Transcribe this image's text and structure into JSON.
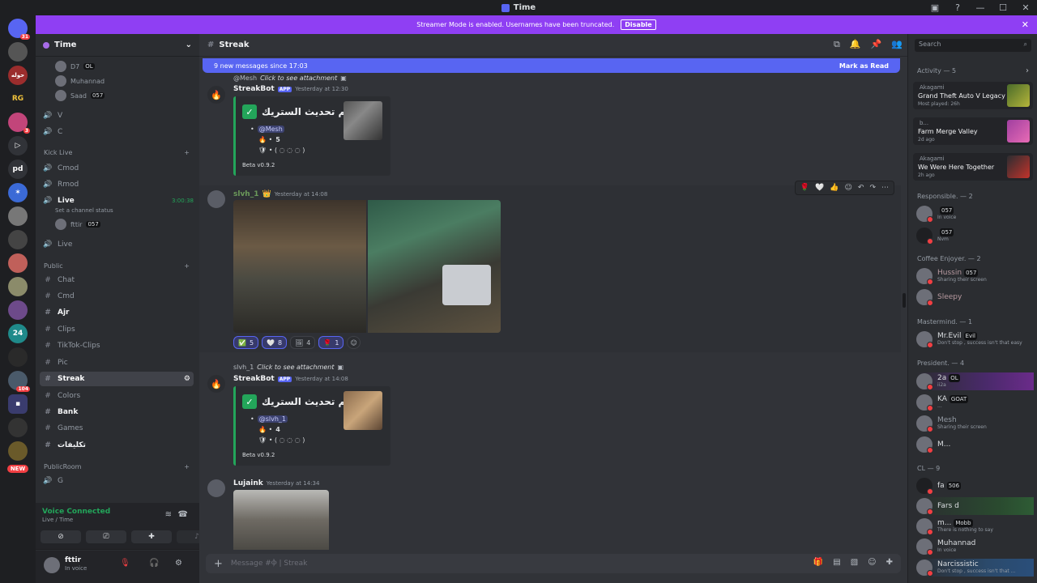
{
  "window": {
    "title": "Time"
  },
  "banner": {
    "text": "Streamer Mode is enabled. Usernames have been truncated.",
    "button": "Disable"
  },
  "servers": {
    "items": [
      {
        "label": "",
        "badge": "31"
      },
      {
        "label": "",
        "badge": ""
      },
      {
        "label": "حوله",
        "badge": ""
      },
      {
        "label": "RG",
        "badge": ""
      },
      {
        "label": "",
        "badge": "3"
      },
      {
        "label": "",
        "badge": ""
      },
      {
        "label": "pd",
        "badge": ""
      },
      {
        "label": "",
        "badge": ""
      },
      {
        "label": "",
        "badge": ""
      },
      {
        "label": "",
        "badge": ""
      },
      {
        "label": "",
        "badge": ""
      },
      {
        "label": "",
        "badge": ""
      },
      {
        "label": "",
        "badge": ""
      },
      {
        "label": "24",
        "badge": ""
      },
      {
        "label": "",
        "badge": ""
      },
      {
        "label": "",
        "badge": "104"
      },
      {
        "label": "",
        "badge": ""
      },
      {
        "label": "",
        "badge": ""
      },
      {
        "label": "",
        "badge": ""
      }
    ],
    "new_badge": "NEW"
  },
  "sidebar": {
    "guild_name": "Time",
    "voice_users_top": [
      {
        "name": "D7",
        "tag": "OL"
      },
      {
        "name": "Muhannad",
        "tag": ""
      },
      {
        "name": "Saad",
        "tag": "057"
      }
    ],
    "channels_top": [
      {
        "name": "V"
      },
      {
        "name": "C"
      }
    ],
    "category_kick": "Kick Live",
    "kick_channels": [
      {
        "name": "Cmod"
      },
      {
        "name": "Rmod"
      },
      {
        "name": "Live",
        "timer": "3:00:38",
        "status": "Set a channel status"
      },
      {
        "name": "Live"
      }
    ],
    "kick_live_user": {
      "name": "fttir",
      "tag": "057"
    },
    "category_public": "Public",
    "public_channels": [
      {
        "name": "Chat"
      },
      {
        "name": "Cmd"
      },
      {
        "name": "Ajr"
      },
      {
        "name": "Clips"
      },
      {
        "name": "TikTok-Clips"
      },
      {
        "name": "Pic"
      },
      {
        "name": "Streak"
      },
      {
        "name": "Colors"
      },
      {
        "name": "Bank"
      },
      {
        "name": "Games"
      },
      {
        "name": "تكليفات"
      }
    ],
    "category_publicroom": "PublicRoom",
    "publicroom_channels": [
      {
        "name": "G"
      }
    ]
  },
  "voice_panel": {
    "status": "Voice Connected",
    "location": "Live / Time"
  },
  "user_panel": {
    "name": "fttir",
    "status": "In voice"
  },
  "chat": {
    "channel_name": "Streak",
    "new_messages": "9 new messages since 17:03",
    "mark_read": "Mark as Read",
    "msg1": {
      "reply_user": "@Mesh",
      "reply_text": "Click to see attachment",
      "author": "StreakBot",
      "app_tag": "APP",
      "time": "Yesterday at 12:30",
      "embed_title": "تم تحديث الستريك •",
      "mention": "@Mesh",
      "count": "5",
      "footer": "Beta v0.9.2"
    },
    "msg2": {
      "author": "slvh_1",
      "time": "Yesterday at 14:08",
      "reactions": [
        {
          "emoji": "✅",
          "count": "5"
        },
        {
          "emoji": "🤍",
          "count": "8"
        },
        {
          "emoji": "🖼",
          "count": "4"
        },
        {
          "emoji": "🌹",
          "count": "1"
        }
      ]
    },
    "msg3": {
      "reply_user": "slvh_1",
      "reply_text": "Click to see attachment",
      "author": "StreakBot",
      "app_tag": "APP",
      "time": "Yesterday at 14:08",
      "embed_title": "تم تحديث الستريك •",
      "mention": "@slvh_1",
      "count": "4",
      "footer": "Beta v0.9.2"
    },
    "msg4": {
      "author": "Lujaink",
      "time": "Yesterday at 14:34"
    },
    "input_placeholder": "Message #Ⲫ | Streak"
  },
  "members": {
    "search_placeholder": "Search",
    "activity_header": "Activity — 5",
    "activities": [
      {
        "user": "Akagami",
        "game": "Grand Theft Auto V Legacy",
        "sub": "Most played: 26h"
      },
      {
        "user": "b...",
        "game": "Farm Merge Valley",
        "sub": "2d ago"
      },
      {
        "user": "Akagami",
        "game": "We Were Here Together",
        "sub": "2h ago"
      }
    ],
    "groups": [
      {
        "header": "Responsible. — 2",
        "members": [
          {
            "name": "",
            "tag": "057",
            "status": "In voice"
          },
          {
            "name": "",
            "tag": "057",
            "status": "Nvm"
          }
        ]
      },
      {
        "header": "Coffee Enjoyer. — 2",
        "members": [
          {
            "name": "Hussin",
            "tag": "057",
            "status": "Sharing their screen"
          },
          {
            "name": "Sleepy",
            "tag": "",
            "status": ""
          }
        ]
      },
      {
        "header": "Mastermind. — 1",
        "members": [
          {
            "name": "Mr.Evil",
            "tag": "Evil",
            "status": "Don't stop , success isn't that easy"
          }
        ]
      },
      {
        "header": "President. — 4",
        "members": [
          {
            "name": "2a",
            "tag": "OL",
            "status": "ii2a"
          },
          {
            "name": "KA",
            "tag": "GOAT",
            "status": "..."
          },
          {
            "name": "Mesh",
            "tag": "",
            "status": "Sharing their screen"
          },
          {
            "name": "M...",
            "tag": "",
            "status": ""
          }
        ]
      },
      {
        "header": "CL — 9",
        "members": [
          {
            "name": "fa",
            "tag": "506",
            "status": ""
          },
          {
            "name": "Fars d",
            "tag": "",
            "status": ""
          },
          {
            "name": "m...",
            "tag": "Mobb",
            "status": "There is nothing to say"
          },
          {
            "name": "Muhannad",
            "tag": "",
            "status": "In voice"
          },
          {
            "name": "Narcissistic",
            "tag": "",
            "status": "Don't stop , success isn't that ..."
          }
        ]
      }
    ]
  }
}
